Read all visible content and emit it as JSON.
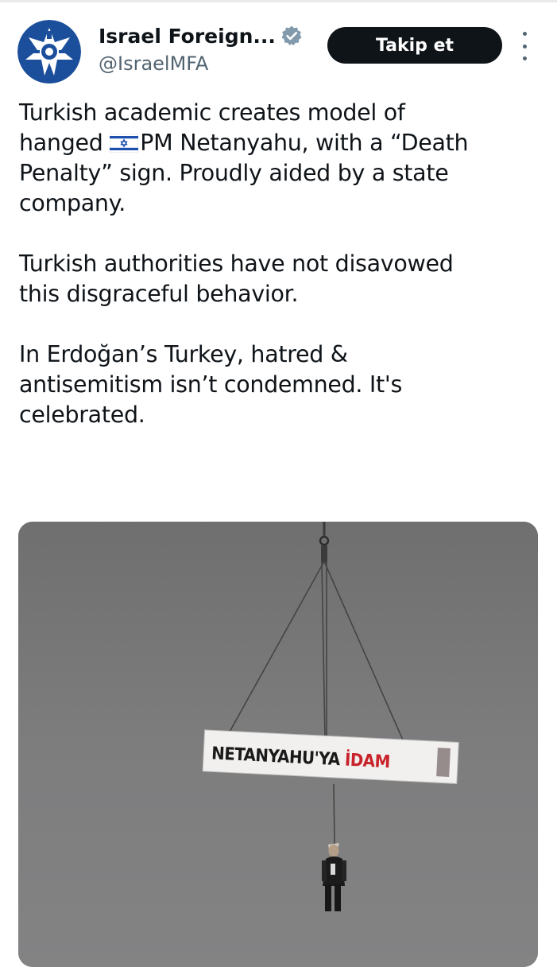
{
  "account": {
    "display_name": "Israel Foreign...",
    "handle": "@IsraelMFA",
    "verified": true,
    "avatar_icon": "israel-mfa-emblem-icon"
  },
  "actions": {
    "follow_label": "Takip et",
    "more_icon": "more-vertical-icon"
  },
  "tweet": {
    "line1_before_flag": "Turkish academic creates model of",
    "line2_prefix": "hanged ",
    "flag_icon": "israel-flag-icon",
    "line2_rest": "PM Netanyahu, with a “Death",
    "line3": "Penalty” sign. Proudly aided by a state",
    "line4": "company.",
    "paragraph2_line1": "Turkish authorities have not disavowed",
    "paragraph2_line2": "this disgraceful behavior.",
    "paragraph3_line1": "In Erdoğan’s Turkey, hatred &",
    "paragraph3_line2": "antisemitism isn’t condemned. It's",
    "paragraph3_line3": "celebrated."
  },
  "media": {
    "banner_text_black": "NETANYAHU'YA ",
    "banner_text_red": "İDAM"
  },
  "colors": {
    "text": "#0f1419",
    "secondary": "#536471",
    "follow_bg": "#0f1419",
    "verified_badge": "#829aab",
    "avatar_blue": "#1b4f9c",
    "banner_red": "#c8222a"
  }
}
